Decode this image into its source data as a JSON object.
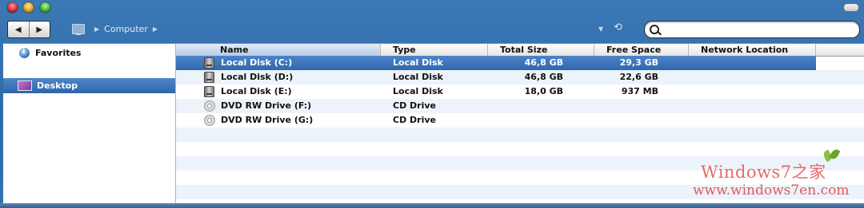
{
  "toolbar": {
    "breadcrumb": "Computer",
    "search_placeholder": "",
    "nav_back": "◀",
    "nav_forward": "▶"
  },
  "sidebar": {
    "items": [
      {
        "label": "Favorites",
        "icon": "info-icon",
        "selected": false
      },
      {
        "label": "Desktop",
        "icon": "desktop-icon",
        "selected": true
      }
    ]
  },
  "columns": [
    "Name",
    "Type",
    "Total Size",
    "Free Space",
    "Network Location"
  ],
  "rows": [
    {
      "name": "Local Disk (C:)",
      "type": "Local Disk",
      "total": "46,8 GB",
      "free": "29,3 GB",
      "icon": "hard-disk-icon",
      "selected": true
    },
    {
      "name": "Local Disk (D:)",
      "type": "Local Disk",
      "total": "46,8 GB",
      "free": "22,6 GB",
      "icon": "hard-disk-icon",
      "selected": false
    },
    {
      "name": "Local Disk (E:)",
      "type": "Local Disk",
      "total": "18,0 GB",
      "free": "937 MB",
      "icon": "hard-disk-icon",
      "selected": false
    },
    {
      "name": "DVD RW Drive (F:)",
      "type": "CD Drive",
      "total": "",
      "free": "",
      "icon": "dvd-icon",
      "selected": false
    },
    {
      "name": "DVD RW Drive (G:)",
      "type": "CD Drive",
      "total": "",
      "free": "",
      "icon": "dvd-icon",
      "selected": false
    }
  ],
  "watermark": {
    "brand": "Windows7之家",
    "url": "www.windows7en.com"
  },
  "colors": {
    "selection": "#3a73b9",
    "window_chrome": "#3571ad",
    "watermark": "#e25858"
  }
}
